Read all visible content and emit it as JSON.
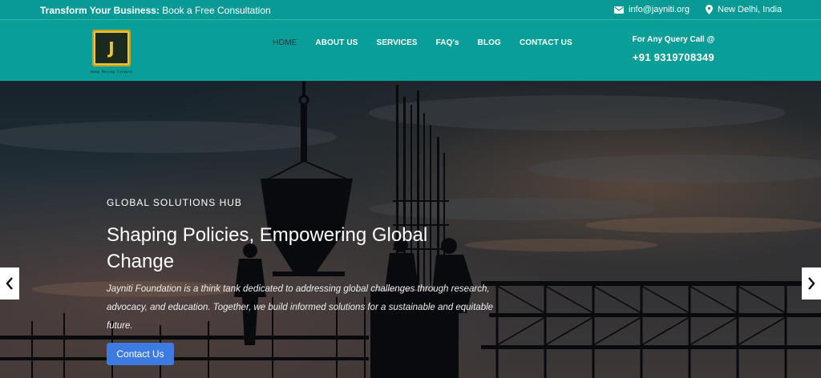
{
  "topbar": {
    "promo_bold": "Transform Your Business:",
    "promo_text": " Book a Free Consultation",
    "email": "info@jayniti.org",
    "location": "New Delhi, India"
  },
  "logo": {
    "letter": "J",
    "tagline": "Keep Moving Forward"
  },
  "nav": {
    "items": [
      {
        "label": "HOME"
      },
      {
        "label": "ABOUT US"
      },
      {
        "label": "SERVICES"
      },
      {
        "label": "FAQ's"
      },
      {
        "label": "BLOG"
      },
      {
        "label": "CONTACT US"
      }
    ]
  },
  "query": {
    "label": "For Any Query Call @",
    "phone": "+91 9319708349"
  },
  "hero": {
    "eyebrow": "GLOBAL SOLUTIONS HUB",
    "headline": "Shaping Policies, Empowering Global Change",
    "description": "Jayniti Foundation is a think tank dedicated to addressing global challenges through research, advocacy, and education. Together, we build informed solutions for a sustainable and equitable future.",
    "cta_label": "Contact Us"
  },
  "colors": {
    "topbar_bg": "#0a9a95",
    "header_bg": "#0a9e99",
    "cta_bg": "#3d7be0",
    "logo_gold": "#f2c52a"
  },
  "icons": {
    "email": "envelope-icon",
    "location": "map-pin-icon",
    "prev": "chevron-left-icon",
    "next": "chevron-right-icon"
  }
}
